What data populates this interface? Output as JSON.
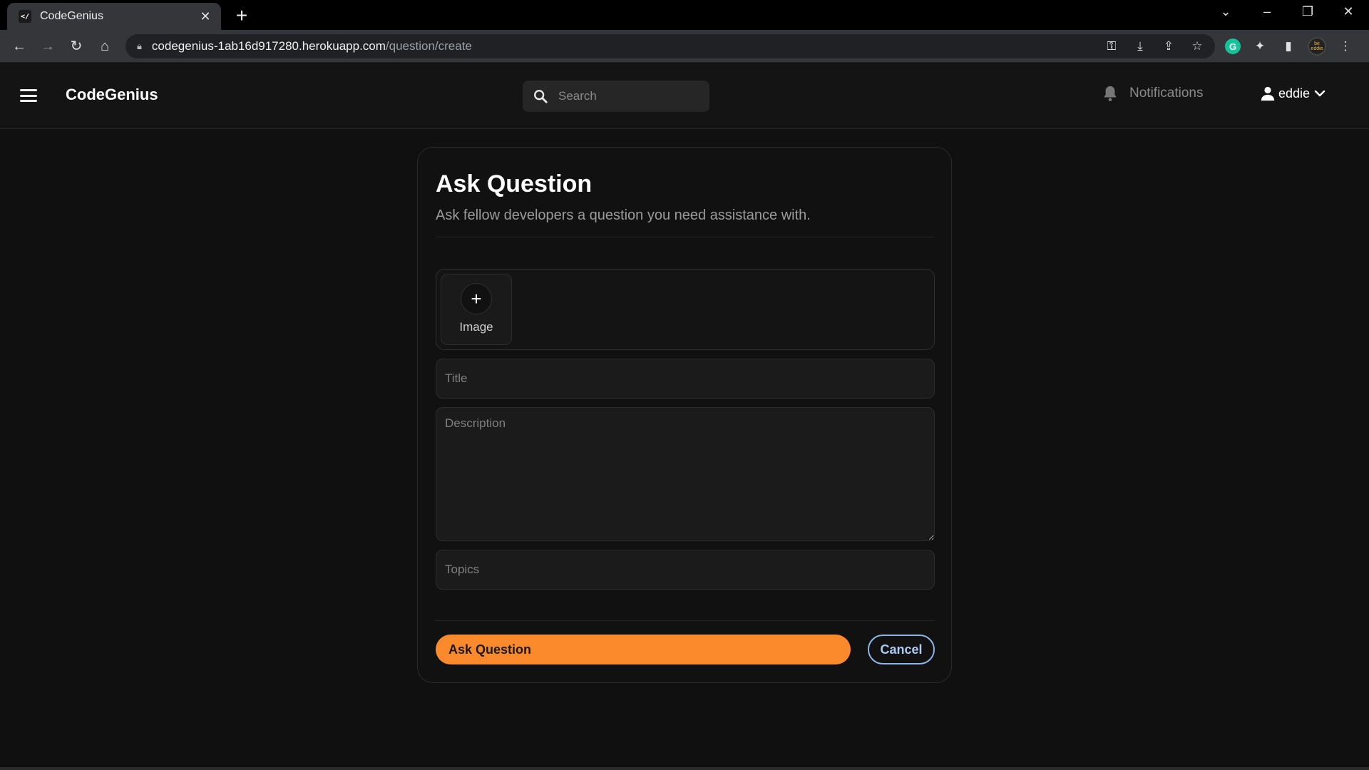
{
  "browser": {
    "tab_title": "CodeGenius",
    "tab_favicon_text": "</",
    "url_host": "codegenius-1ab16d917280.herokuapp.com",
    "url_path": "/question/create",
    "profile_text": "be eddie"
  },
  "header": {
    "brand": "CodeGenius",
    "search_placeholder": "Search",
    "notifications_label": "Notifications",
    "username": "eddie"
  },
  "form": {
    "title": "Ask Question",
    "subtitle": "Ask fellow developers a question you need assistance with.",
    "image_label": "Image",
    "title_placeholder": "Title",
    "description_placeholder": "Description",
    "topics_placeholder": "Topics",
    "submit_label": "Ask Question",
    "cancel_label": "Cancel"
  },
  "colors": {
    "accent": "#fb8a2c",
    "cancel_border": "#8db6e8",
    "background": "#101010"
  }
}
